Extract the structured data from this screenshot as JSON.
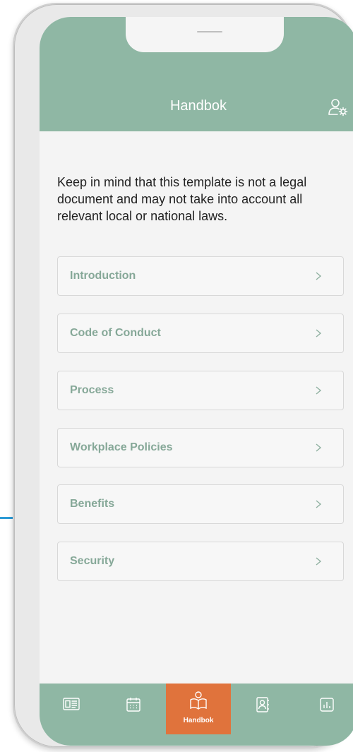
{
  "colors": {
    "header_bg": "#8fb7a4",
    "nav_bg": "#8fb7a4",
    "active_tab_bg": "#e0733c",
    "menu_text": "#86a898",
    "screen_bg": "#f4f4f4"
  },
  "header": {
    "title": "Handbok",
    "settings_icon": "user-settings-icon"
  },
  "intro_text": "Keep in mind that this template is not a legal document and may not take into account all relevant local or national laws.",
  "menu": {
    "items": [
      {
        "label": "Introduction",
        "chevron": ">"
      },
      {
        "label": "Code of Conduct",
        "chevron": ">"
      },
      {
        "label": "Process",
        "chevron": ">"
      },
      {
        "label": "Workplace Policies",
        "chevron": ">"
      },
      {
        "label": "Benefits",
        "chevron": ">"
      },
      {
        "label": "Security",
        "chevron": ">"
      }
    ]
  },
  "bottom_nav": {
    "items": [
      {
        "icon": "news-icon",
        "label": ""
      },
      {
        "icon": "calendar-icon",
        "label": ""
      },
      {
        "icon": "book-icon",
        "label": "Handbok",
        "active": true
      },
      {
        "icon": "contacts-icon",
        "label": ""
      },
      {
        "icon": "chart-icon",
        "label": ""
      }
    ]
  }
}
